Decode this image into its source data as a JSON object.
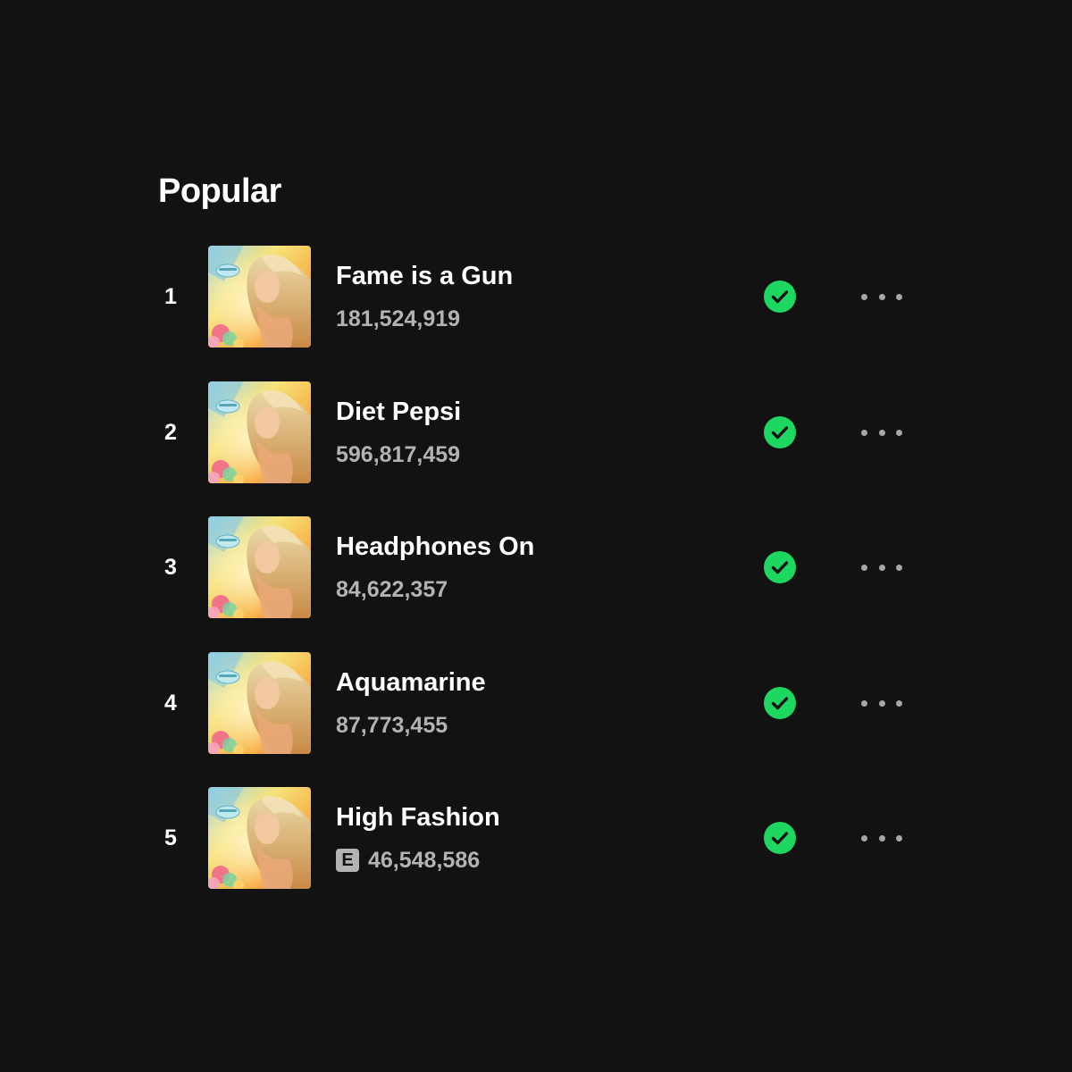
{
  "section": {
    "title": "Popular"
  },
  "colors": {
    "background": "#121212",
    "accent_green": "#1ed760",
    "secondary_text": "#b3b3b3"
  },
  "tracks": [
    {
      "number": "1",
      "title": "Fame is a Gun",
      "plays": "181,524,919",
      "explicit": false,
      "explicit_label": "",
      "saved": true
    },
    {
      "number": "2",
      "title": "Diet Pepsi",
      "plays": "596,817,459",
      "explicit": false,
      "explicit_label": "",
      "saved": true
    },
    {
      "number": "3",
      "title": "Headphones On",
      "plays": "84,622,357",
      "explicit": false,
      "explicit_label": "",
      "saved": true
    },
    {
      "number": "4",
      "title": "Aquamarine",
      "plays": "87,773,455",
      "explicit": false,
      "explicit_label": "",
      "saved": true
    },
    {
      "number": "5",
      "title": "High Fashion",
      "plays": "46,548,586",
      "explicit": true,
      "explicit_label": "E",
      "saved": true
    }
  ],
  "icons": {
    "saved": "check-circle-icon",
    "more": "more-options-icon"
  }
}
